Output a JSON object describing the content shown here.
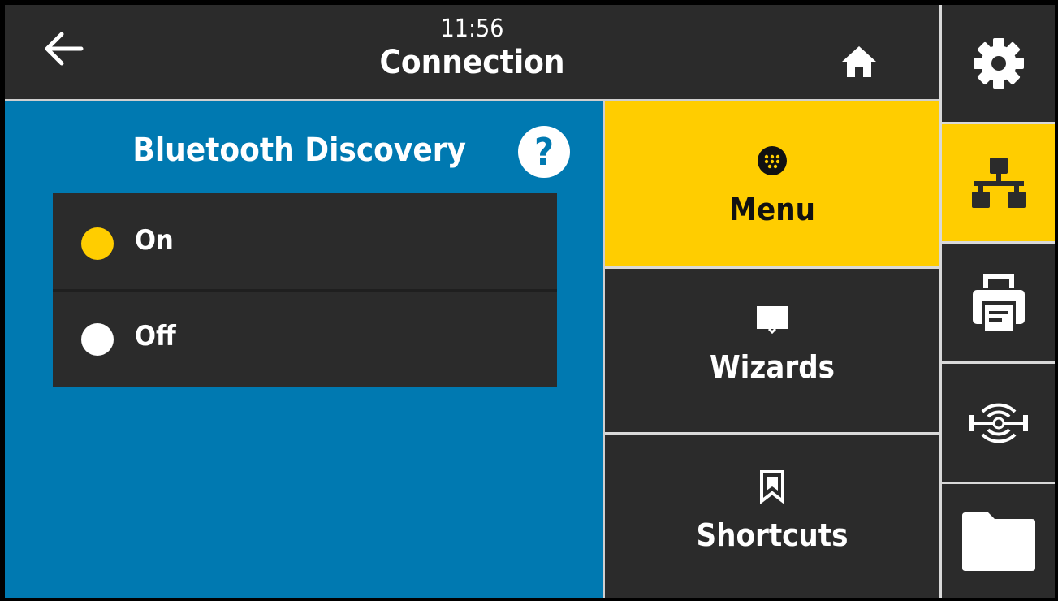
{
  "header": {
    "time": "11:56",
    "title": "Connection",
    "back_icon": "arrow-left-icon",
    "home_icon": "home-icon"
  },
  "setting": {
    "title": "Bluetooth Discovery",
    "help_label": "?",
    "options": [
      {
        "label": "On",
        "selected": true
      },
      {
        "label": "Off",
        "selected": false
      }
    ]
  },
  "tiles": [
    {
      "label": "Menu",
      "icon": "grid-circle-icon",
      "active": true
    },
    {
      "label": "Wizards",
      "icon": "book-icon",
      "active": false
    },
    {
      "label": "Shortcuts",
      "icon": "bookmark-icon",
      "active": false
    }
  ],
  "rail": [
    {
      "icon": "gear-icon",
      "active": false
    },
    {
      "icon": "network-icon",
      "active": true
    },
    {
      "icon": "printer-icon",
      "active": false
    },
    {
      "icon": "sensor-icon",
      "active": false
    },
    {
      "icon": "folder-icon",
      "active": false
    }
  ],
  "colors": {
    "accent": "#ffcd00",
    "panel_blue": "#0079b1",
    "background": "#2b2b2b",
    "text": "#ffffff"
  }
}
